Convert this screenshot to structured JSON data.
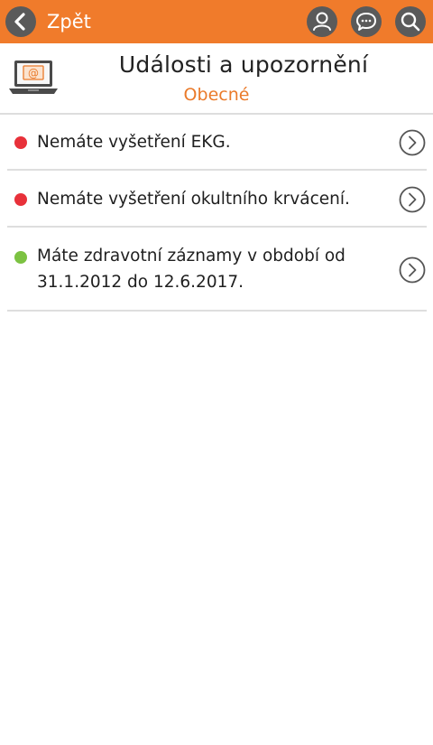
{
  "topbar": {
    "back_label": "Zpět",
    "icons": [
      "user-icon",
      "chat-icon",
      "search-icon"
    ],
    "bar_color": "#f07b2b"
  },
  "header": {
    "title": "Události a upozornění",
    "subtitle": "Obecné",
    "icon": "laptop-email-icon"
  },
  "items": [
    {
      "text": "Nemáte vyšetření EKG.",
      "status": "red",
      "color": "#e8313a"
    },
    {
      "text": "Nemáte vyšetření okultního krvácení.",
      "status": "red",
      "color": "#e8313a"
    },
    {
      "text": "Máte zdravotní záznamy v období od 31.1.2012 do 12.6.2017.",
      "status": "green",
      "color": "#7cc242"
    }
  ]
}
